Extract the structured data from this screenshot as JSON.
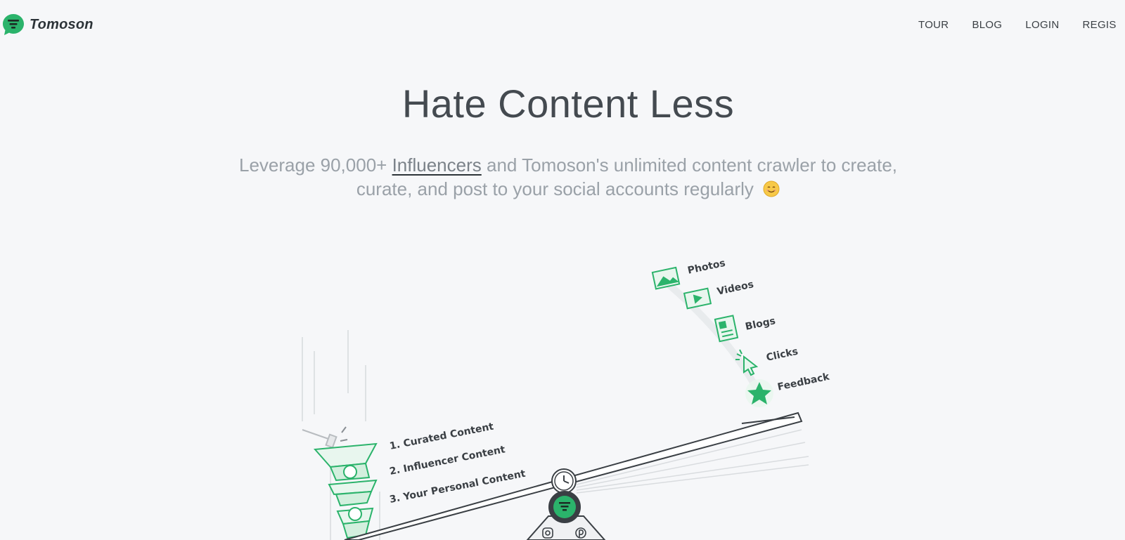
{
  "header": {
    "brand": "Tomoson",
    "logo_icon": "chat-bubble-filter-icon",
    "nav": [
      {
        "label": "TOUR"
      },
      {
        "label": "BLOG"
      },
      {
        "label": "LOGIN"
      },
      {
        "label": "REGIS"
      }
    ]
  },
  "hero": {
    "title": "Hate Content Less",
    "subtitle_before": "Leverage 90,000+ ",
    "subtitle_link": "Influencers",
    "subtitle_after": " and Tomoson's unlimited content crawler to create, curate, and post to your social accounts regularly",
    "emoji": "smiling-face-icon"
  },
  "illustration": {
    "left_items": [
      {
        "label": "1. Curated Content"
      },
      {
        "label": "2. Influencer Content"
      },
      {
        "label": "3. Your Personal Content"
      }
    ],
    "right_items": [
      {
        "label": "Photos",
        "icon": "photo-icon"
      },
      {
        "label": "Videos",
        "icon": "video-icon"
      },
      {
        "label": "Blogs",
        "icon": "blog-icon"
      },
      {
        "label": "Clicks",
        "icon": "cursor-click-icon"
      },
      {
        "label": "Feedback",
        "icon": "star-icon"
      }
    ],
    "fulcrum_icons": [
      "clock-icon",
      "tomoson-logo-icon",
      "instagram-icon",
      "pinterest-icon"
    ]
  },
  "colors": {
    "brand_green": "#2bb36b",
    "background": "#f6f7f9",
    "title": "#444a50",
    "subtitle": "#9aa1a8"
  }
}
